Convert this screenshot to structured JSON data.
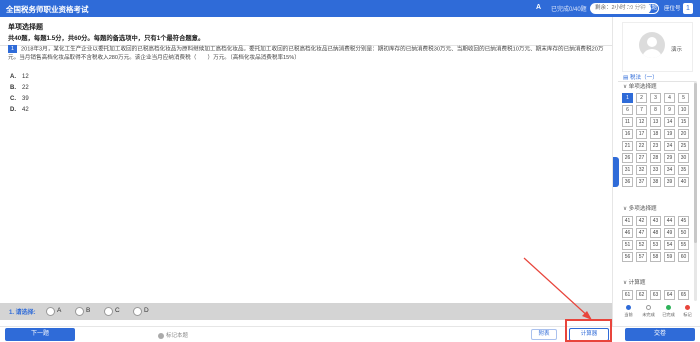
{
  "header": {
    "title": "全国税务师职业资格考试",
    "font_icon": "A",
    "answered": "已完成0/40题",
    "timer": "剩余：2小时 29 分钟",
    "close_label": "X 关闭试题",
    "seat_label": "座位号",
    "seat_number": "1"
  },
  "section": {
    "title": "单项选择题",
    "desc": "共40题，每题1.5分，共60分。每题的备选项中，只有1个最符合题意。"
  },
  "question": {
    "number": "1",
    "text": "2018年3月，某化工生产企业以委托加工收回的已税高档化妆品为原料继续加工高档化妆品。委托加工收回的已税高档化妆品已纳消费税分别是：期初库存的已纳消费税30万元、当期收回的已纳消费税10万元、期末库存的已纳消费税20万元。当月销售高档化妆品取得不含税收入280万元。该企业当月应纳消费税（　　）万元。（高档化妆品消费税率15%）",
    "options": [
      {
        "letter": "A.",
        "text": "12"
      },
      {
        "letter": "B.",
        "text": "22"
      },
      {
        "letter": "C.",
        "text": "39"
      },
      {
        "letter": "D.",
        "text": "42"
      }
    ]
  },
  "answer_bar": {
    "label": "1. 请选择:",
    "choices": [
      "A",
      "B",
      "C",
      "D"
    ]
  },
  "footer": {
    "prev_label": "下一题",
    "mark_label": "标记本题",
    "attach_label": "附表",
    "calc_label": "计算器",
    "submit_label": "交卷"
  },
  "sidebar": {
    "user_name": "演示",
    "section_label": "税法（一）",
    "groups": [
      {
        "label": "单项选择题",
        "items": [
          "1",
          "2",
          "3",
          "4",
          "5",
          "6",
          "7",
          "8",
          "9",
          "10",
          "11",
          "12",
          "13",
          "14",
          "15",
          "16",
          "17",
          "18",
          "19",
          "20",
          "21",
          "22",
          "23",
          "24",
          "25",
          "26",
          "27",
          "28",
          "29",
          "30",
          "31",
          "32",
          "33",
          "34",
          "35",
          "36",
          "37",
          "38",
          "39",
          "40"
        ],
        "active": "1"
      },
      {
        "label": "多项选择题",
        "items": [
          "41",
          "42",
          "43",
          "44",
          "45",
          "46",
          "47",
          "48",
          "49",
          "50",
          "51",
          "52",
          "53",
          "54",
          "55",
          "56",
          "57",
          "58",
          "59",
          "60"
        ]
      },
      {
        "label": "计算题",
        "items": [
          "61",
          "62",
          "63",
          "64",
          "65"
        ]
      }
    ],
    "legend": [
      {
        "label": "当前",
        "color": "#2f6bd8"
      },
      {
        "label": "未完成",
        "color": "#ffffff"
      },
      {
        "label": "已完成",
        "color": "#2fb35a"
      },
      {
        "label": "标记",
        "color": "#e8453c"
      }
    ]
  },
  "colors": {
    "primary": "#2f6bd8",
    "highlight": "#e8453c"
  }
}
